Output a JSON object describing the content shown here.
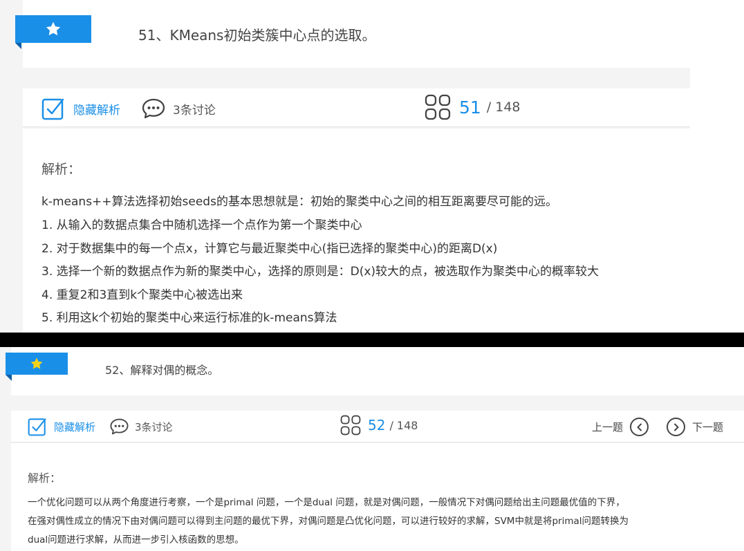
{
  "colors": {
    "accent": "#1a8fe8",
    "star": "#f5d21a",
    "text": "#333333"
  },
  "card1": {
    "question_title": "51、KMeans初始类簇中心点的选取。",
    "toolbar": {
      "hide_label": "隐藏解析",
      "discussion_label": "3条讨论",
      "current": "51",
      "total": "/ 148"
    },
    "analysis": {
      "heading": "解析：",
      "lines": [
        "k-means++算法选择初始seeds的基本思想就是：初始的聚类中心之间的相互距离要尽可能的远。",
        "1. 从输入的数据点集合中随机选择一个点作为第一个聚类中心",
        "2. 对于数据集中的每一个点x，计算它与最近聚类中心(指已选择的聚类中心)的距离D(x)",
        "3. 选择一个新的数据点作为新的聚类中心，选择的原则是：D(x)较大的点，被选取作为聚类中心的概率较大",
        "4. 重复2和3直到k个聚类中心被选出来",
        "5. 利用这k个初始的聚类中心来运行标准的k-means算法"
      ]
    }
  },
  "card2": {
    "question_title": "52、解释对偶的概念。",
    "toolbar": {
      "hide_label": "隐藏解析",
      "discussion_label": "3条讨论",
      "current": "52",
      "total": "/ 148",
      "prev_label": "上一题",
      "next_label": "下一题"
    },
    "analysis": {
      "heading": "解析：",
      "lines": [
        "一个优化问题可以从两个角度进行考察，一个是primal 问题，一个是dual 问题，就是对偶问题，一般情况下对偶问题给出主问题最优值的下界，",
        "在强对偶性成立的情况下由对偶问题可以得到主问题的最优下界，对偶问题是凸优化问题，可以进行较好的求解，SVM中就是将primal问题转换为",
        "dual问题进行求解，从而进一步引入核函数的思想。"
      ]
    }
  }
}
